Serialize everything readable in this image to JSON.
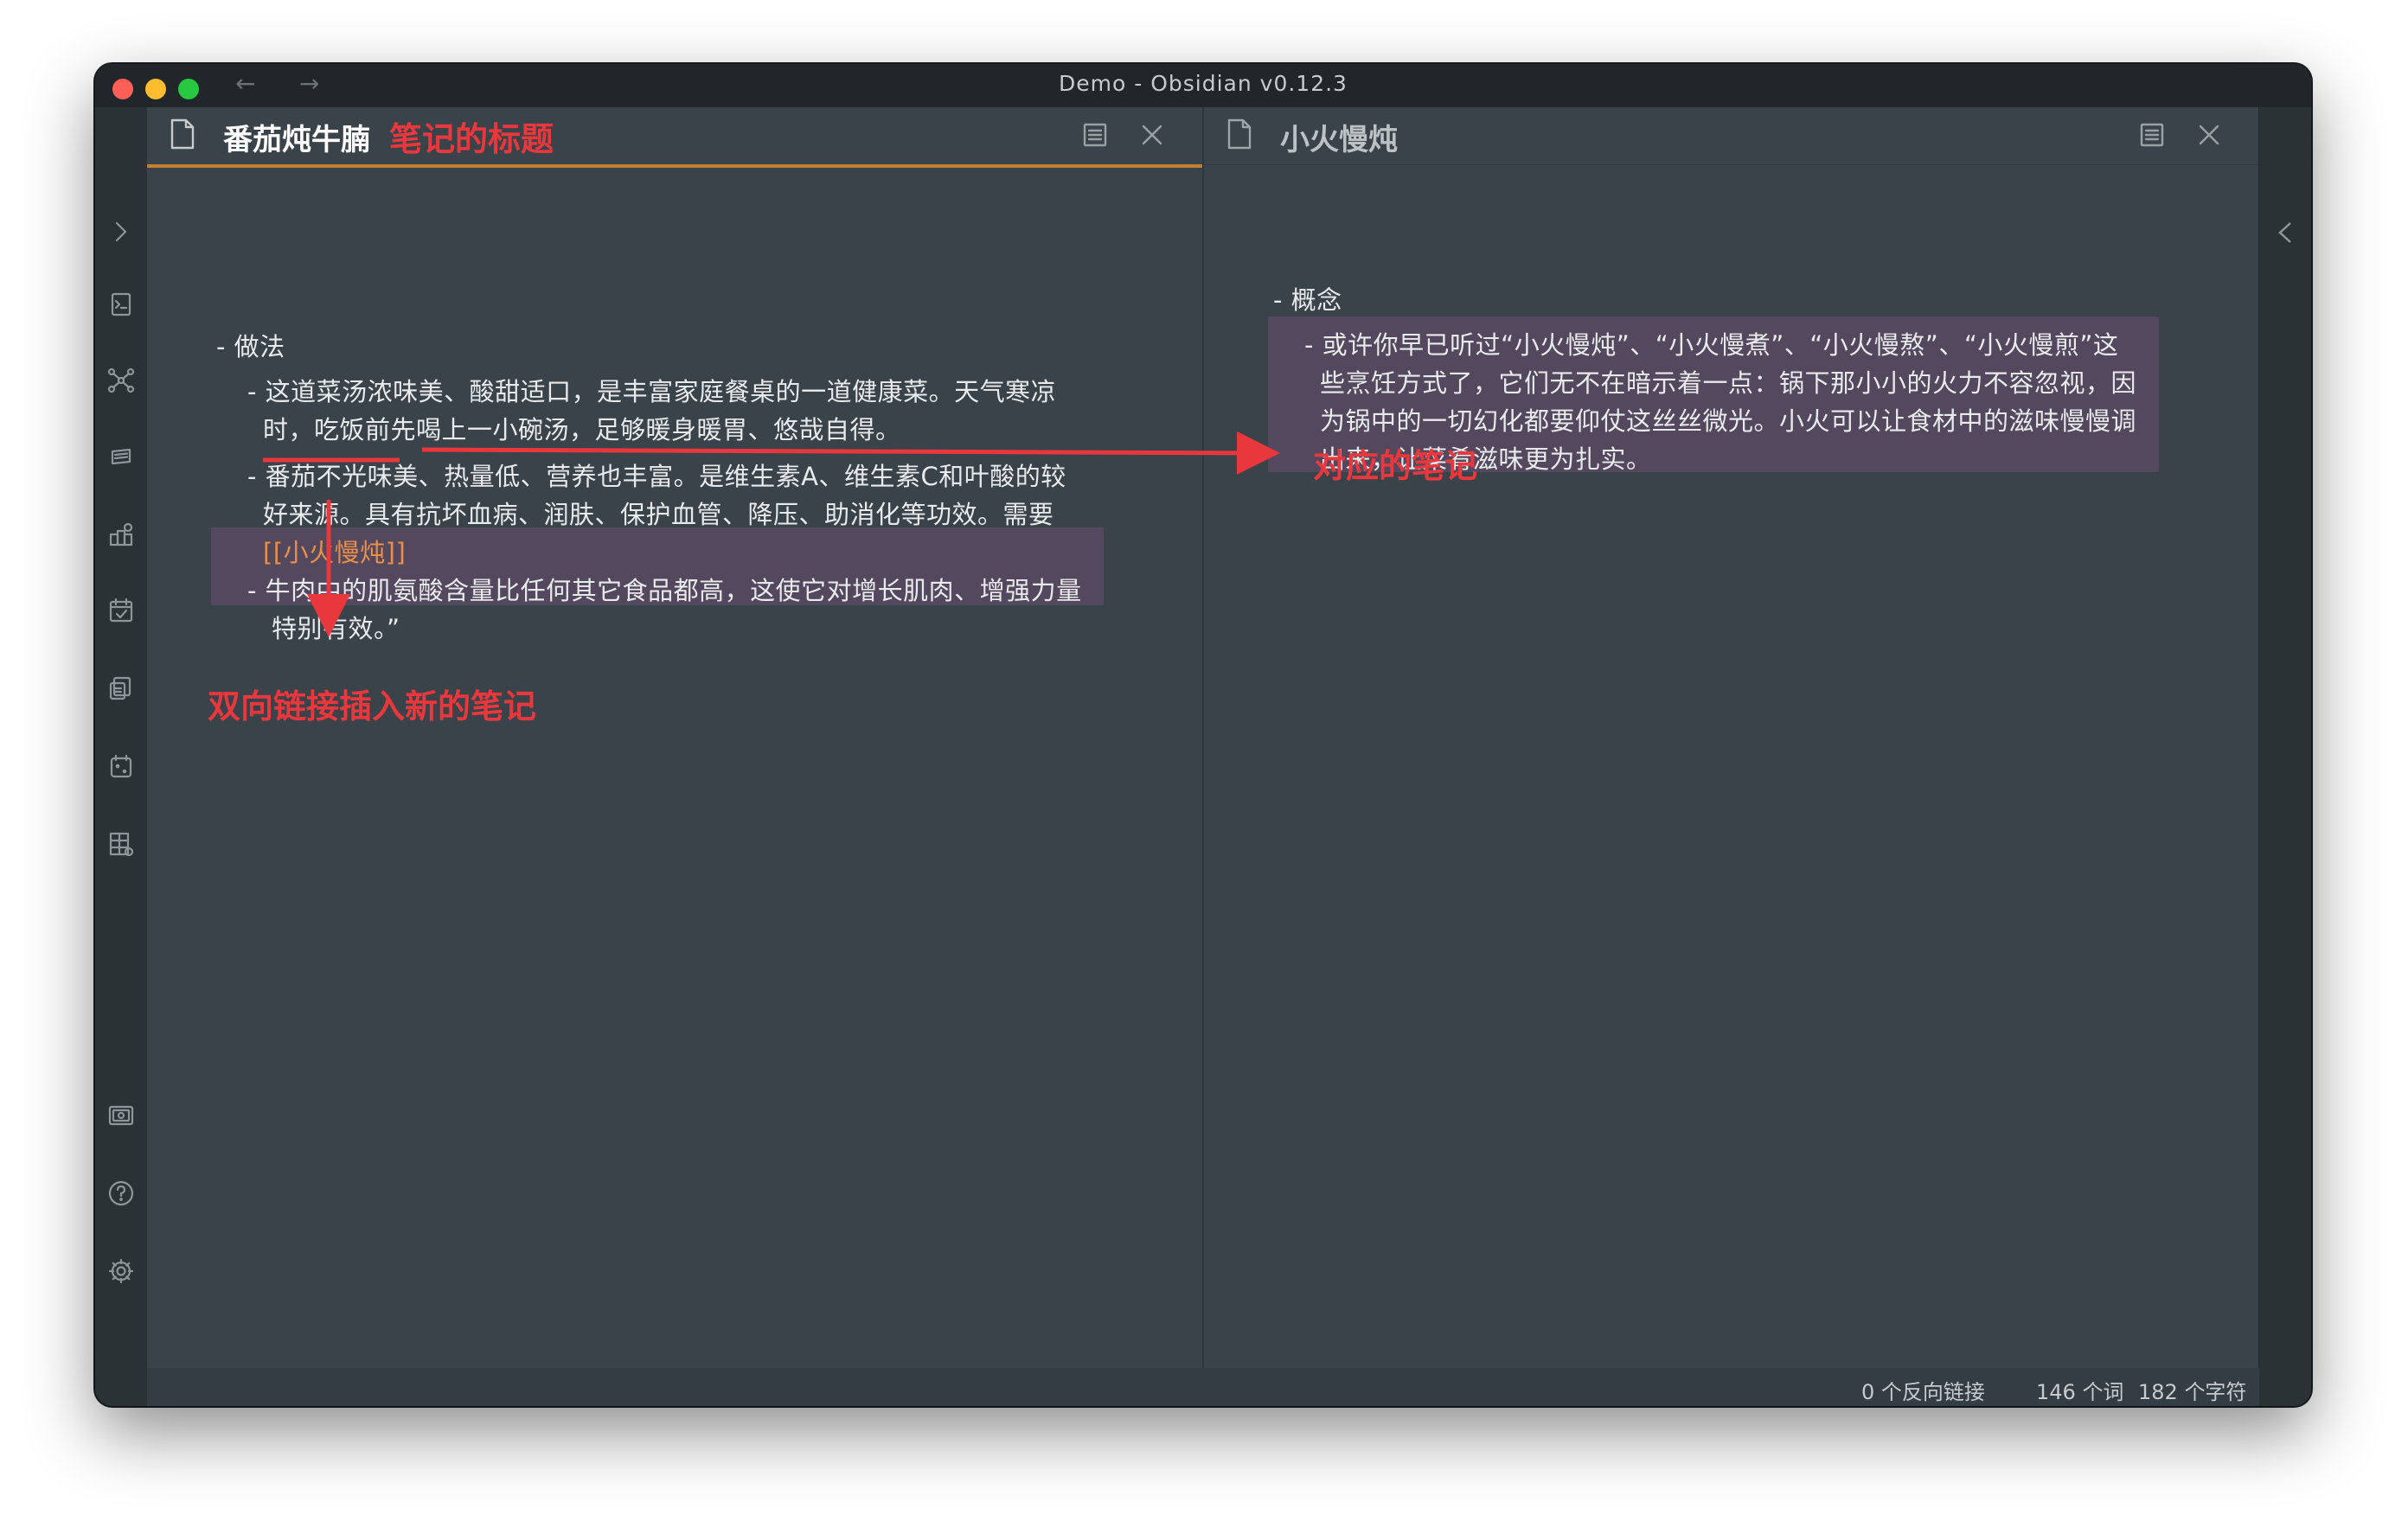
{
  "window": {
    "title": "Demo - Obsidian v0.12.3",
    "nav_back": "←",
    "nav_forward": "→"
  },
  "left_pane": {
    "title": "番茄炖牛腩",
    "bullet_heading": "- 做法",
    "items": [
      {
        "lines": [
          "- 这道菜汤浓味美、酸甜适口，是丰富家庭餐桌的一道健康菜。天气寒凉",
          "时，吃饭前先喝上一小碗汤，足够暖身暖胃、悠哉自得。"
        ]
      },
      {
        "lines": [
          "- 番茄不光味美、热量低、营养也丰富。是维生素A、维生素C和叶酸的较",
          "好来源。具有抗坏血病、润肤、保护血管、降压、助消化等功效。需要"
        ],
        "link": "[[小火慢炖]]"
      },
      {
        "lines": [
          "- 牛肉中的肌氨酸含量比任何其它食品都高，这使它对增长肌肉、增强力量",
          "特别有效。”"
        ]
      }
    ]
  },
  "right_pane": {
    "title": "小火慢炖",
    "bullet_heading": "- 概念",
    "lines": [
      "- 或许你早已听过“小火慢炖”、“小火慢煮”、“小火慢熬”、“小火慢煎”这",
      "些烹饪方式了，它们无不在暗示着一点：锅下那小小的火力不容忽视，因",
      "为锅中的一切幻化都要仰仗这丝丝微光。小火可以让食材中的滋味慢慢调",
      "出来，让菜肴滋味更为扎实。"
    ]
  },
  "annotations": {
    "title_note": "笔记的标题",
    "linked_note": "对应的笔记",
    "bidirectional": "双向链接插入新的笔记"
  },
  "status_bar": {
    "backlinks": "0 个反向链接",
    "words": "146 个词",
    "chars": "182 个字符"
  },
  "ribbon_icons": [
    "open-quick-switcher-icon",
    "graph-view-icon",
    "slides-icon",
    "sync-icon",
    "daily-note-icon",
    "templates-icon",
    "random-note-icon",
    "workspaces-icon",
    "vault-icon",
    "help-icon",
    "settings-icon"
  ],
  "colors": {
    "annotation": "#e8383d",
    "link": "#e88f4b",
    "active_tab_border": "#c07f30",
    "highlight": "#54485f"
  }
}
